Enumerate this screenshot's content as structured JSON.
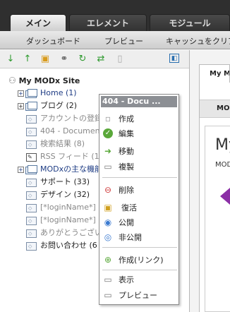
{
  "tabs": {
    "main": "メイン",
    "element": "エレメント",
    "module": "モジュール"
  },
  "submenu": {
    "dashboard": "ダッシュボード",
    "preview": "プレビュー",
    "clear_cache": "キャッシュをクリア"
  },
  "tree": {
    "root_label": "My MODx Site",
    "nodes": [
      {
        "label": "Home (1)"
      },
      {
        "label": "ブログ (2)"
      },
      {
        "label": "アカウントの登録"
      },
      {
        "label": "404 - Document"
      },
      {
        "label": "検索結果 (8)"
      },
      {
        "label": "RSS フィード (1"
      },
      {
        "label": "MODxの主な機能"
      },
      {
        "label": "サポート (33)"
      },
      {
        "label": "デザイン (32)"
      },
      {
        "label": "[*loginName*]"
      },
      {
        "label": "[*loginName*]"
      },
      {
        "label": "ありがとうござい"
      },
      {
        "label": "お問い合わせ (6"
      }
    ]
  },
  "context_menu": {
    "title": "404 - Docu ...",
    "items": {
      "create": "作成",
      "edit": "編集",
      "move": "移動",
      "duplicate": "複製",
      "delete": "削除",
      "restore": "復活",
      "publish": "公開",
      "unpublish": "非公開",
      "create_link": "作成(リンク)",
      "view": "表示",
      "preview": "プレビュー"
    }
  },
  "right_panel": {
    "tab_label": "My MOD",
    "strip_label": "MOD",
    "big_text": "My",
    "small_text": "MOD"
  },
  "colors": {
    "topbar": "#2f2f2f",
    "tree_link": "#1e3c84",
    "unpublished": "#888888",
    "menu_title_bg": "#8c8f94",
    "accent_purple": "#8b2fa6"
  }
}
